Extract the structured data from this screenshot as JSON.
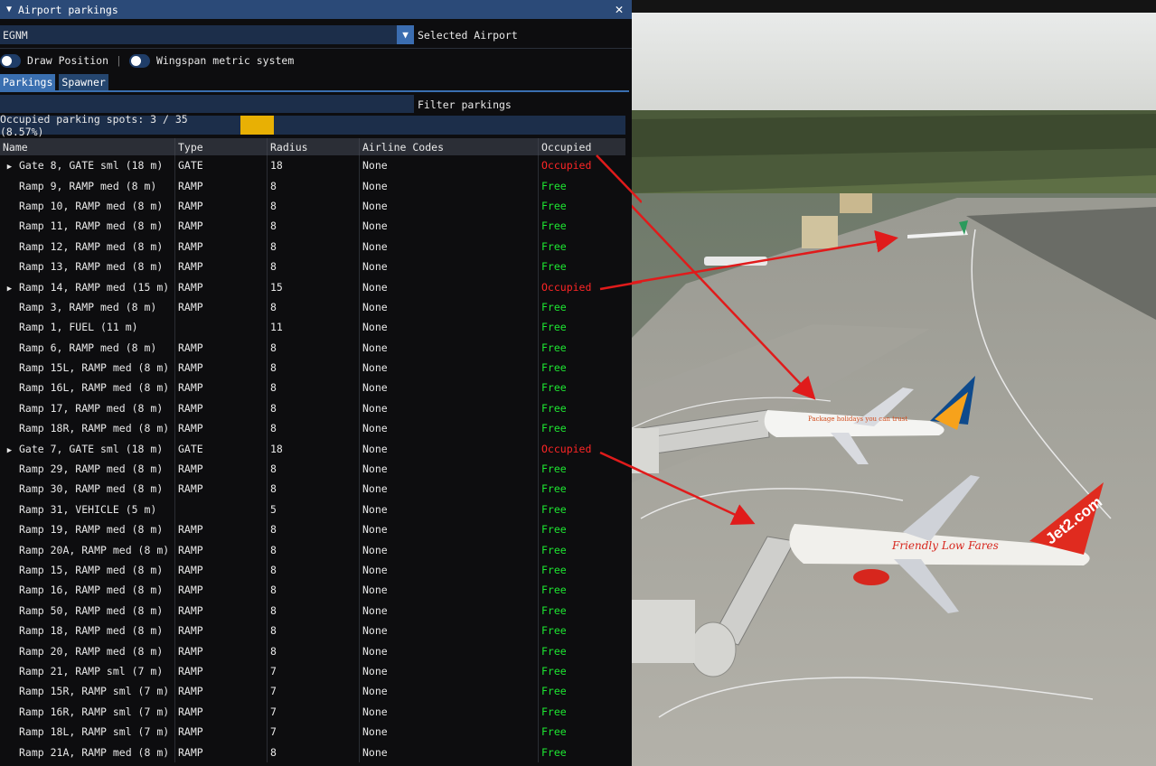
{
  "window": {
    "title": "Airport parkings",
    "collapse_glyph": "▼",
    "close_glyph": "✕"
  },
  "airport": {
    "value": "EGNM",
    "label": "Selected Airport",
    "arrow_glyph": "▼"
  },
  "toggles": {
    "draw_position": "Draw Position",
    "separator": "|",
    "wingspan": "Wingspan metric system"
  },
  "tabs": [
    "Parkings",
    "Spawner"
  ],
  "filter": {
    "label": "Filter parkings",
    "value": ""
  },
  "stats": {
    "text": "Occupied parking spots: 3 / 35 (8.57%)",
    "fraction": 0.0857
  },
  "columns": [
    "Name",
    "Type",
    "Radius",
    "Airline Codes",
    "Occupied"
  ],
  "rows": [
    {
      "name": "Gate 8, GATE sml (18 m)",
      "type": "GATE",
      "radius": "18",
      "airline": "None",
      "status": "Occupied",
      "expandable": true
    },
    {
      "name": "Ramp 9, RAMP med (8 m)",
      "type": "RAMP",
      "radius": "8",
      "airline": "None",
      "status": "Free",
      "expandable": false
    },
    {
      "name": "Ramp 10, RAMP med (8 m)",
      "type": "RAMP",
      "radius": "8",
      "airline": "None",
      "status": "Free",
      "expandable": false
    },
    {
      "name": "Ramp 11, RAMP med (8 m)",
      "type": "RAMP",
      "radius": "8",
      "airline": "None",
      "status": "Free",
      "expandable": false
    },
    {
      "name": "Ramp 12, RAMP med (8 m)",
      "type": "RAMP",
      "radius": "8",
      "airline": "None",
      "status": "Free",
      "expandable": false
    },
    {
      "name": "Ramp 13, RAMP med (8 m)",
      "type": "RAMP",
      "radius": "8",
      "airline": "None",
      "status": "Free",
      "expandable": false
    },
    {
      "name": "Ramp 14, RAMP med (15 m)",
      "type": "RAMP",
      "radius": "15",
      "airline": "None",
      "status": "Occupied",
      "expandable": true
    },
    {
      "name": "Ramp 3, RAMP med (8 m)",
      "type": "RAMP",
      "radius": "8",
      "airline": "None",
      "status": "Free",
      "expandable": false
    },
    {
      "name": "Ramp 1, FUEL (11 m)",
      "type": "",
      "radius": "11",
      "airline": "None",
      "status": "Free",
      "expandable": false
    },
    {
      "name": "Ramp 6, RAMP med (8 m)",
      "type": "RAMP",
      "radius": "8",
      "airline": "None",
      "status": "Free",
      "expandable": false
    },
    {
      "name": "Ramp 15L, RAMP med (8 m)",
      "type": "RAMP",
      "radius": "8",
      "airline": "None",
      "status": "Free",
      "expandable": false
    },
    {
      "name": "Ramp 16L, RAMP med (8 m)",
      "type": "RAMP",
      "radius": "8",
      "airline": "None",
      "status": "Free",
      "expandable": false
    },
    {
      "name": "Ramp 17, RAMP med (8 m)",
      "type": "RAMP",
      "radius": "8",
      "airline": "None",
      "status": "Free",
      "expandable": false
    },
    {
      "name": "Ramp 18R, RAMP med (8 m)",
      "type": "RAMP",
      "radius": "8",
      "airline": "None",
      "status": "Free",
      "expandable": false
    },
    {
      "name": "Gate 7, GATE sml (18 m)",
      "type": "GATE",
      "radius": "18",
      "airline": "None",
      "status": "Occupied",
      "expandable": true
    },
    {
      "name": "Ramp 29, RAMP med (8 m)",
      "type": "RAMP",
      "radius": "8",
      "airline": "None",
      "status": "Free",
      "expandable": false
    },
    {
      "name": "Ramp 30, RAMP med (8 m)",
      "type": "RAMP",
      "radius": "8",
      "airline": "None",
      "status": "Free",
      "expandable": false
    },
    {
      "name": "Ramp 31, VEHICLE (5 m)",
      "type": "",
      "radius": "5",
      "airline": "None",
      "status": "Free",
      "expandable": false
    },
    {
      "name": "Ramp 19, RAMP med (8 m)",
      "type": "RAMP",
      "radius": "8",
      "airline": "None",
      "status": "Free",
      "expandable": false
    },
    {
      "name": "Ramp 20A, RAMP med (8 m)",
      "type": "RAMP",
      "radius": "8",
      "airline": "None",
      "status": "Free",
      "expandable": false
    },
    {
      "name": "Ramp 15, RAMP med (8 m)",
      "type": "RAMP",
      "radius": "8",
      "airline": "None",
      "status": "Free",
      "expandable": false
    },
    {
      "name": "Ramp 16, RAMP med (8 m)",
      "type": "RAMP",
      "radius": "8",
      "airline": "None",
      "status": "Free",
      "expandable": false
    },
    {
      "name": "Ramp 50, RAMP med (8 m)",
      "type": "RAMP",
      "radius": "8",
      "airline": "None",
      "status": "Free",
      "expandable": false
    },
    {
      "name": "Ramp 18, RAMP med (8 m)",
      "type": "RAMP",
      "radius": "8",
      "airline": "None",
      "status": "Free",
      "expandable": false
    },
    {
      "name": "Ramp 20, RAMP med (8 m)",
      "type": "RAMP",
      "radius": "8",
      "airline": "None",
      "status": "Free",
      "expandable": false
    },
    {
      "name": "Ramp 21, RAMP sml (7 m)",
      "type": "RAMP",
      "radius": "7",
      "airline": "None",
      "status": "Free",
      "expandable": false
    },
    {
      "name": "Ramp 15R, RAMP sml (7 m)",
      "type": "RAMP",
      "radius": "7",
      "airline": "None",
      "status": "Free",
      "expandable": false
    },
    {
      "name": "Ramp 16R, RAMP sml (7 m)",
      "type": "RAMP",
      "radius": "7",
      "airline": "None",
      "status": "Free",
      "expandable": false
    },
    {
      "name": "Ramp 18L, RAMP sml (7 m)",
      "type": "RAMP",
      "radius": "7",
      "airline": "None",
      "status": "Free",
      "expandable": false
    },
    {
      "name": "Ramp 21A, RAMP med (8 m)",
      "type": "RAMP",
      "radius": "8",
      "airline": "None",
      "status": "Free",
      "expandable": false
    }
  ],
  "colors": {
    "free": "#1ee832",
    "occupied": "#ff2626",
    "accent": "#3a6fb0",
    "progress": "#e8b004",
    "arrow": "#e01b1b"
  },
  "scene": {
    "livery_jet2": "Jet2.com",
    "livery_jet2_slogan": "Friendly Low Fares",
    "livery_holidays": "Package holidays you can trust"
  }
}
